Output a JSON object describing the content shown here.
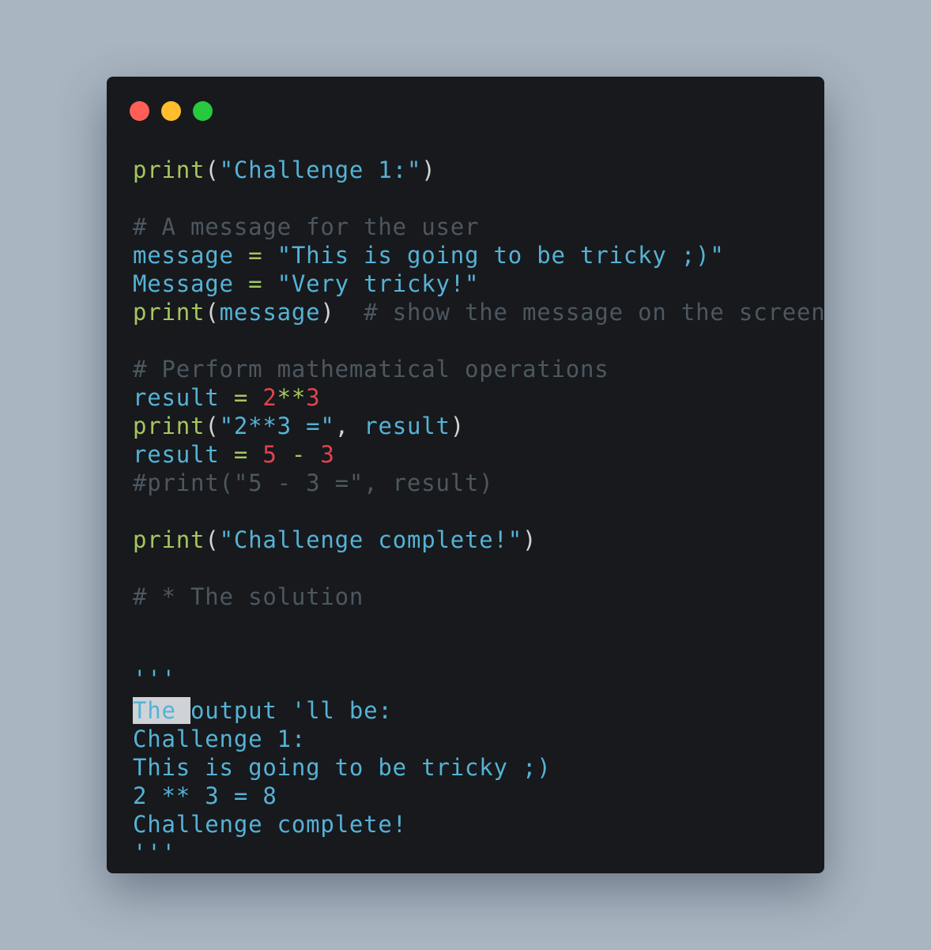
{
  "window": {
    "controls": [
      "close",
      "minimize",
      "maximize"
    ]
  },
  "code": {
    "l1": {
      "kw": "print",
      "open": "(",
      "str": "\"Challenge 1:\"",
      "close": ")"
    },
    "l3": "# A message for the user",
    "l4": {
      "var": "message",
      "op": " = ",
      "str": "\"This is going to be tricky ;)\""
    },
    "l5": {
      "var": "Message",
      "op": " = ",
      "str": "\"Very tricky!\""
    },
    "l6": {
      "kw": "print",
      "open": "(",
      "arg": "message",
      "close": ")",
      "cmt": "  # show the message on the screen"
    },
    "l8": "# Perform mathematical operations",
    "l9": {
      "var": "result",
      "op": " = ",
      "n1": "2",
      "pow": "**",
      "n2": "3"
    },
    "l10": {
      "kw": "print",
      "open": "(",
      "str": "\"2**3 =\"",
      "comma": ", ",
      "arg": "result",
      "close": ")"
    },
    "l11": {
      "var": "result",
      "op": " = ",
      "n1": "5",
      "minus": " - ",
      "n2": "3"
    },
    "l12": "#print(\"5 - 3 =\", result)",
    "l14": {
      "kw": "print",
      "open": "(",
      "str": "\"Challenge complete!\"",
      "close": ")"
    },
    "l16": "# * The solution",
    "l19": "'''",
    "l20": {
      "hl": "The ",
      "rest": "output 'll be:"
    },
    "l21": "Challenge 1:",
    "l22": "This is going to be tricky ;)",
    "l23": "2 ** 3 = 8",
    "l24": "Challenge complete!",
    "l25": "'''"
  }
}
